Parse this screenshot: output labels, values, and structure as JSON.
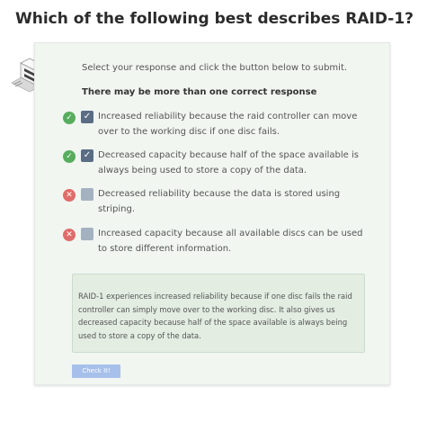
{
  "question": {
    "title": "Which of the following best describes RAID-1?"
  },
  "card": {
    "instructions": "Select your response and click the button below to submit.",
    "hint": "There may be more than one correct response",
    "options": [
      {
        "text": "Increased reliability because the raid controller can move over to the working disc if one disc fails.",
        "checked": true,
        "status": "correct",
        "status_icon": "check-icon"
      },
      {
        "text": "Decreased capacity because half of the space available is always being used to store a copy of the data.",
        "checked": true,
        "status": "correct",
        "status_icon": "check-icon"
      },
      {
        "text": "Decreased reliability because the data is stored using striping.",
        "checked": false,
        "status": "wrong",
        "status_icon": "cross-icon"
      },
      {
        "text": "Increased capacity because all available discs can be used to store different information.",
        "checked": false,
        "status": "wrong",
        "status_icon": "cross-icon"
      }
    ],
    "feedback": "RAID-1 experiences increased reliability because if one disc fails the raid controller can simply move over to the working disc. It also gives us decreased capacity because half of the space available is always being used to store a copy of the data.",
    "button_label": "Check It!"
  },
  "colors": {
    "correct": "#57ad5d",
    "wrong": "#e06b6b",
    "checkbox_checked": "#5b6d85",
    "checkbox_unchecked": "#a4b1c0",
    "button": "#a6c0ea",
    "card_background": "#f1f6f1",
    "feedback_background": "#e3ede2"
  }
}
